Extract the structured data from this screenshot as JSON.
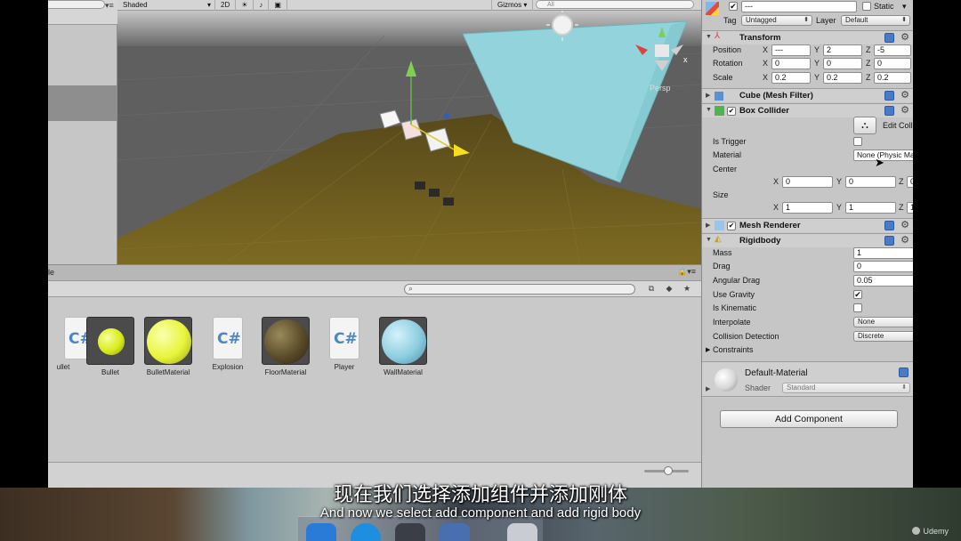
{
  "scene": {
    "toolbar": {
      "shading": "Shaded",
      "mode_2d": "2D",
      "gizmos": "Gizmos",
      "search_placeholder": "All"
    },
    "persp_label": "Persp",
    "gizmo_x": "x"
  },
  "project": {
    "tab_suffix": "le",
    "assets": [
      {
        "name": "ullet",
        "kind": "script"
      },
      {
        "name": "Bullet",
        "kind": "material",
        "color": "#d9ec1a"
      },
      {
        "name": "BulletMaterial",
        "kind": "material",
        "color": "#e8f53a"
      },
      {
        "name": "Explosion",
        "kind": "script"
      },
      {
        "name": "FloorMaterial",
        "kind": "material",
        "color": "#5a4c2a"
      },
      {
        "name": "Player",
        "kind": "script"
      },
      {
        "name": "WallMaterial",
        "kind": "material",
        "color": "#8ecde0"
      }
    ]
  },
  "inspector": {
    "header": {
      "name": "---",
      "static_label": "Static",
      "tag_label": "Tag",
      "tag_value": "Untagged",
      "layer_label": "Layer",
      "layer_value": "Default"
    },
    "transform": {
      "title": "Transform",
      "position_label": "Position",
      "position": {
        "x": "---",
        "y": "2",
        "z": "-5"
      },
      "rotation_label": "Rotation",
      "rotation": {
        "x": "0",
        "y": "0",
        "z": "0"
      },
      "scale_label": "Scale",
      "scale": {
        "x": "0.2",
        "y": "0.2",
        "z": "0.2"
      }
    },
    "mesh_filter": {
      "title": "Cube (Mesh Filter)"
    },
    "box_collider": {
      "title": "Box Collider",
      "edit_collider": "Edit Collider",
      "is_trigger_label": "Is Trigger",
      "material_label": "Material",
      "material_value": "None (Physic Material",
      "center_label": "Center",
      "center": {
        "x": "0",
        "y": "0",
        "z": "0"
      },
      "size_label": "Size",
      "size": {
        "x": "1",
        "y": "1",
        "z": "1"
      }
    },
    "mesh_renderer": {
      "title": "Mesh Renderer"
    },
    "rigidbody": {
      "title": "Rigidbody",
      "mass_label": "Mass",
      "mass": "1",
      "drag_label": "Drag",
      "drag": "0",
      "angular_drag_label": "Angular Drag",
      "angular_drag": "0.05",
      "use_gravity_label": "Use Gravity",
      "use_gravity": true,
      "is_kinematic_label": "Is Kinematic",
      "is_kinematic": false,
      "interpolate_label": "Interpolate",
      "interpolate": "None",
      "collision_label": "Collision Detection",
      "collision": "Discrete",
      "constraints_label": "Constraints"
    },
    "material": {
      "name": "Default-Material",
      "shader_label": "Shader",
      "shader_value": "Standard"
    },
    "add_component": "Add Component"
  },
  "subtitles": {
    "cn": "现在我们选择添加组件并添加刚体",
    "en": "And now we select add component and add rigid body"
  },
  "watermark": "Udemy",
  "colors": {
    "ground": "#6f5e1e",
    "wall": "#8fd3dc",
    "sky": "#bdbdbd"
  }
}
